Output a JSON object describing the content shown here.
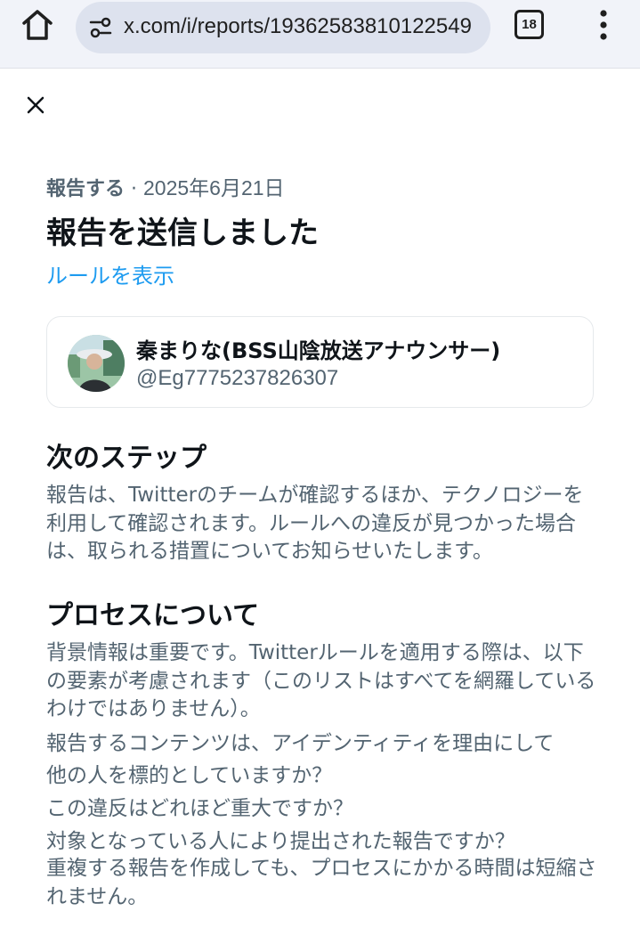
{
  "browser": {
    "url": "x.com/i/reports/19362583810122549",
    "tab_count": "18",
    "icons": [
      "home-icon",
      "site-settings-icon",
      "tab-switcher-icon",
      "more-vert-icon"
    ]
  },
  "report": {
    "close_icon": "close-icon",
    "breadcrumb": "報告する",
    "separator": " · ",
    "date": "2025年6月21日",
    "title": "報告を送信しました",
    "rules_link": "ルールを表示"
  },
  "account": {
    "name": "秦まりな(BSS山陰放送アナウンサー)",
    "handle": "@Eg7775237826307"
  },
  "next_steps": {
    "heading": "次のステップ",
    "body": "報告は、Twitterのチームが確認するほか、テクノロジーを利用して確認されます。ルールへの違反が見つかった場合は、取られる措置についてお知らせいたします。"
  },
  "process": {
    "heading": "プロセスについて",
    "intro": "背景情報は重要です。Twitterルールを適用する際は、以下の要素が考慮されます（このリストはすべてを網羅しているわけではありません）。",
    "q1_line1": "報告するコンテンツは、アイデンティティを理由にして",
    "q1_line2": "他の人を標的としていますか？",
    "q2": "この違反はどれほど重大ですか？",
    "q3": "対象となっている人により提出された報告ですか？",
    "note": "重複する報告を作成しても、プロセスにかかる時間は短縮されません。"
  },
  "colors": {
    "link": "#1d9bf0",
    "secondary_text": "#536471",
    "primary_text": "#0f1419",
    "browser_bar": "#f1f3f9",
    "url_box": "#dde2ee"
  }
}
